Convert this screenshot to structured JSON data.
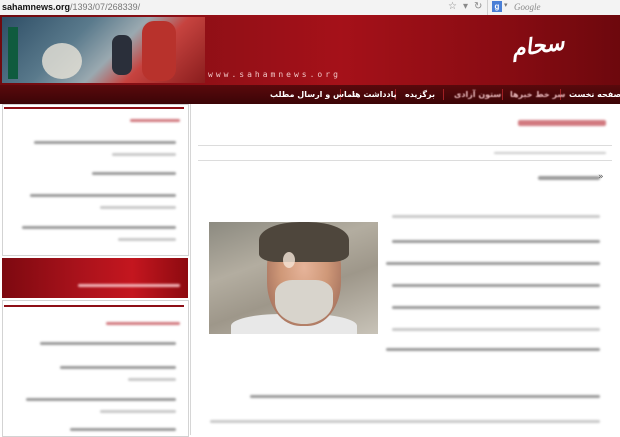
{
  "browser": {
    "url_domain": "sahamnews.org",
    "url_path": "/1393/07/268339/",
    "search_placeholder": "Google",
    "search_engine_letter": "g"
  },
  "header": {
    "domain_text": "www.sahamnews.org",
    "logo_text": "سحام نیوز"
  },
  "nav": {
    "items": [
      {
        "label": "صفحه نخست"
      },
      {
        "label": "سر خط خبرها"
      },
      {
        "label": "ستون آزادی"
      },
      {
        "label": "برگزیده"
      },
      {
        "label": "یادداشت ها"
      },
      {
        "label": "تماس و ارسال مطلب"
      }
    ]
  },
  "colors": {
    "brand_red": "#8e0f16",
    "nav_dark": "#3b0507",
    "accent_banner": "#c4161f"
  }
}
